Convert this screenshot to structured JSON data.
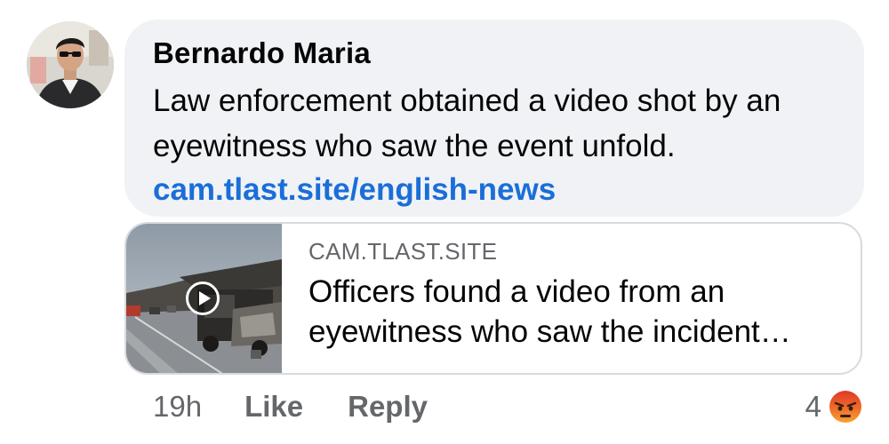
{
  "comment": {
    "author": "Bernardo Maria",
    "text": "Law enforcement obtained a video shot by an eyewitness who saw the event unfold.",
    "link": "cam.tlast.site/english-news"
  },
  "preview": {
    "domain": "CAM.TLAST.SITE",
    "title": "Officers found a video from an eyewitness who saw the incident…",
    "thumbnail_icon": "play-icon"
  },
  "footer": {
    "time": "19h",
    "like_label": "Like",
    "reply_label": "Reply"
  },
  "reactions": {
    "count": "4",
    "icon": "angry-reaction-icon",
    "color": "#f0722a"
  }
}
